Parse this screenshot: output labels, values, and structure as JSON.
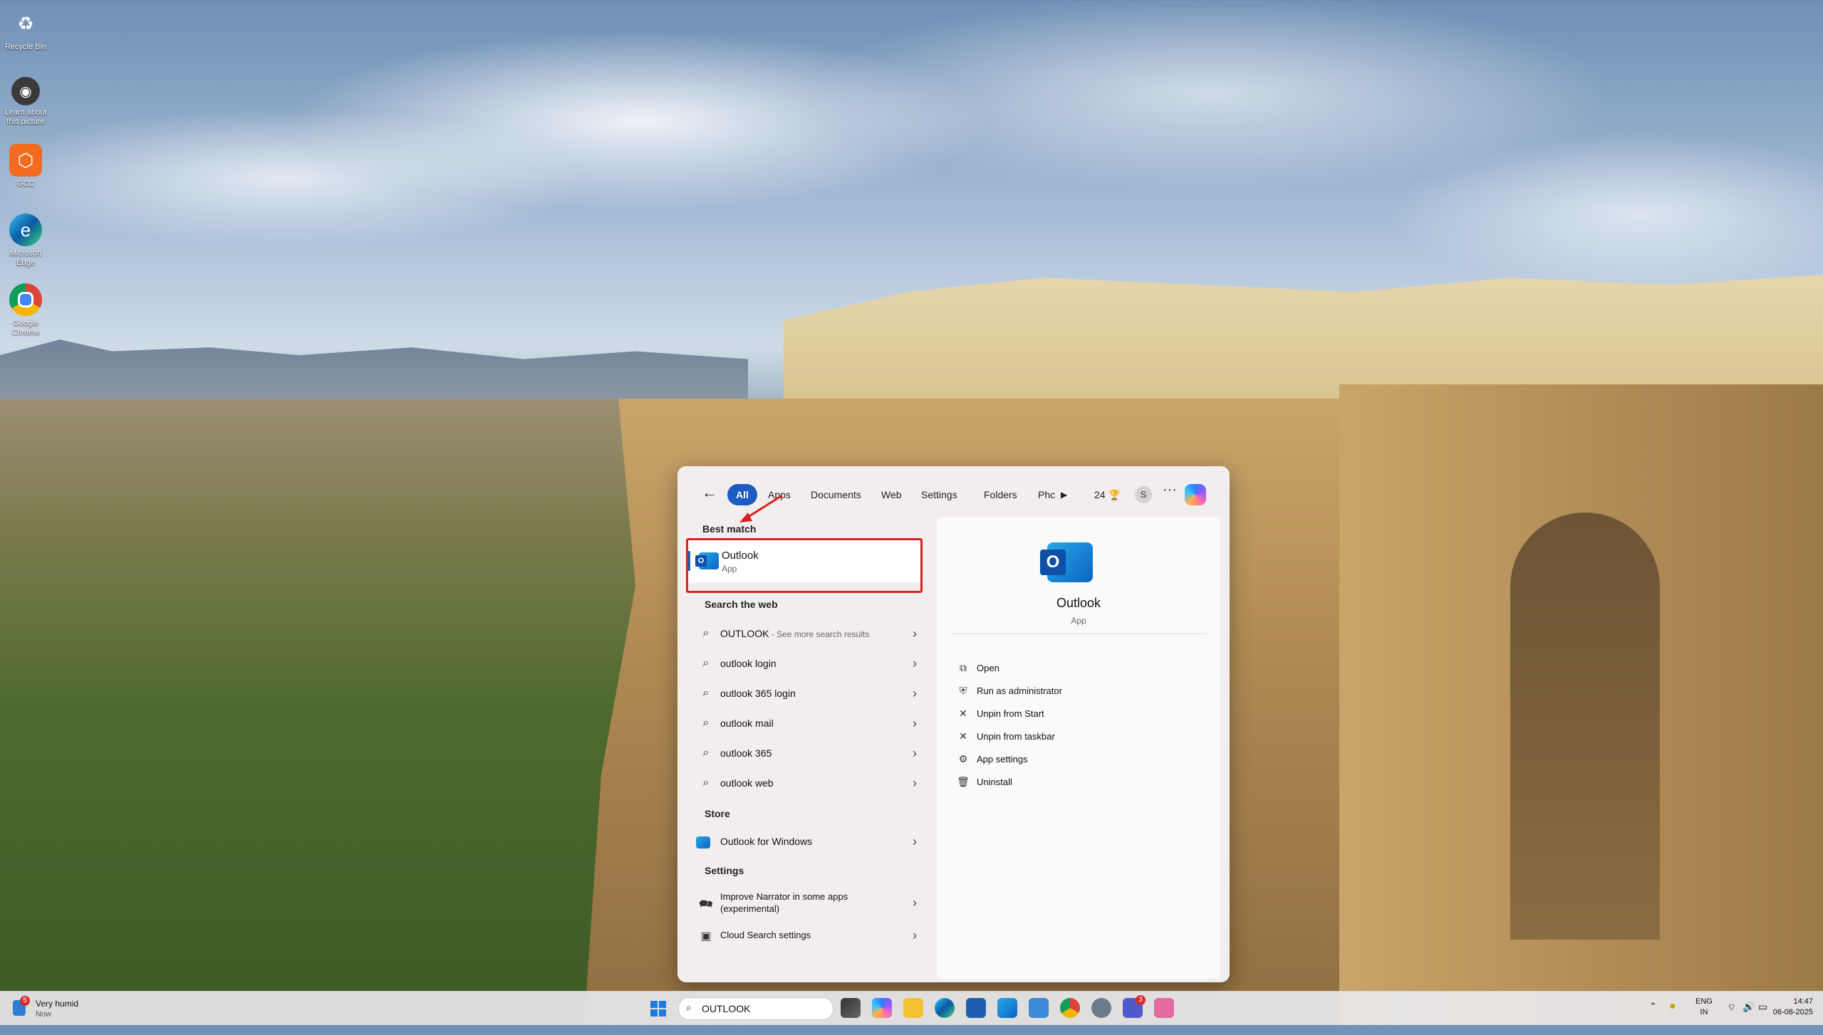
{
  "desktop": {
    "icons": [
      {
        "label": "Recycle Bin",
        "icon": "recycle-bin-icon"
      },
      {
        "label": "Learn about this picture",
        "icon": "camera-icon"
      },
      {
        "label": "GCC",
        "icon": "gcc-icon"
      },
      {
        "label": "Microsoft Edge",
        "icon": "edge-icon"
      },
      {
        "label": "Google Chrome",
        "icon": "chrome-icon"
      }
    ]
  },
  "search_panel": {
    "filters": [
      "All",
      "Apps",
      "Documents",
      "Web",
      "Settings",
      "Folders",
      "Phc"
    ],
    "points": "24",
    "avatar_letter": "S",
    "more": "···",
    "best_match_heading": "Best match",
    "best_match": {
      "name": "Outlook",
      "type": "App"
    },
    "search_web_heading": "Search the web",
    "web_results": [
      {
        "text": "OUTLOOK",
        "suffix": " - See more search results"
      },
      {
        "text": "outlook login",
        "suffix": ""
      },
      {
        "text": "outlook 365 login",
        "suffix": ""
      },
      {
        "text": "outlook mail",
        "suffix": ""
      },
      {
        "text": "outlook 365",
        "suffix": ""
      },
      {
        "text": "outlook web",
        "suffix": ""
      }
    ],
    "store_heading": "Store",
    "store_result": "Outlook for Windows",
    "settings_heading": "Settings",
    "settings_results": [
      "Improve Narrator in some apps (experimental)",
      "Cloud Search settings"
    ],
    "preview": {
      "title": "Outlook",
      "subtitle": "App",
      "actions": [
        "Open",
        "Run as administrator",
        "Unpin from Start",
        "Unpin from taskbar",
        "App settings",
        "Uninstall"
      ]
    }
  },
  "taskbar": {
    "weather_badge": "5",
    "weather_text": "Very humid",
    "weather_sub": "Now",
    "search_value": "OUTLOOK",
    "teams_badge": "3",
    "language": "ENG",
    "region": "IN",
    "time": "14:47",
    "date": "06-08-2025"
  }
}
